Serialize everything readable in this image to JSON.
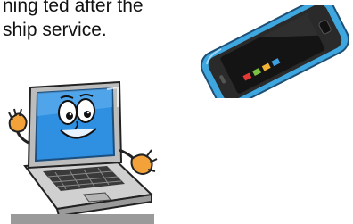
{
  "text": {
    "line1": "ning ted after the",
    "line2": "ship service."
  },
  "illustrations": {
    "phone_icon": "smartphone-icon",
    "laptop_icon": "laptop-cartoon-icon"
  },
  "colors": {
    "phone_body": "#3fa7e0",
    "phone_screen": "#1c1c1c",
    "laptop_screen": "#2f8fe0",
    "laptop_body": "#c8c8c8",
    "hand": "#f3a23a"
  }
}
